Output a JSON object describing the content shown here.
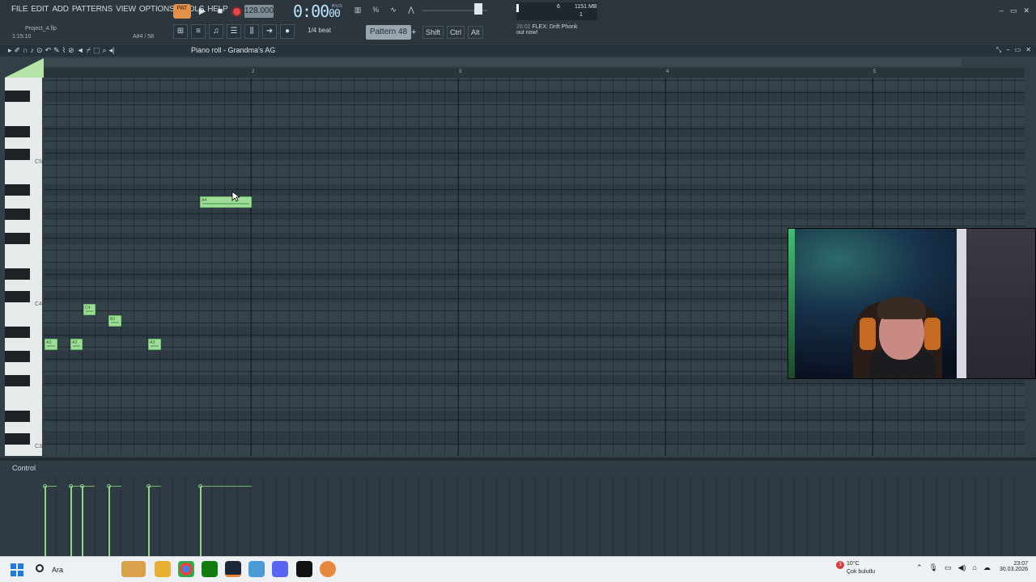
{
  "menu": [
    "FILE",
    "EDIT",
    "ADD",
    "PATTERNS",
    "VIEW",
    "OPTIONS",
    "TOOLS",
    "HELP"
  ],
  "project": {
    "name": "Project_4.flp",
    "time": "1:15:10",
    "hint": "A#4 / 58"
  },
  "transport": {
    "pat_label": "PAT",
    "tempo": "128.000",
    "clock": "0:00",
    "clock_sub": "00",
    "clock_unit": "M:S:CS"
  },
  "cpu": {
    "value_a": "6",
    "memory": "1151 MB",
    "value_c": "1"
  },
  "snap": "1/4 beat",
  "pattern": "Pattern 48",
  "modifiers": [
    "Shift",
    "Ctrl",
    "Alt"
  ],
  "news": {
    "time": "26:02",
    "line1": "FLEX: Drift Phonk",
    "line2": "out now!"
  },
  "piano_roll": {
    "title": "Piano roll - Grandma's AG"
  },
  "ruler": [
    "2",
    "3",
    "4",
    "5"
  ],
  "octaves": [
    "C5",
    "C4",
    "C3"
  ],
  "notes": [
    {
      "label": "A4",
      "pitch": "A4"
    },
    {
      "label": "C4",
      "pitch": "C4"
    },
    {
      "label": "B3",
      "pitch": "B3"
    },
    {
      "label": "A3",
      "pitch": "A3"
    },
    {
      "label": "A3",
      "pitch": "A3"
    },
    {
      "label": "A3",
      "pitch": "A3"
    }
  ],
  "control": {
    "label": "Control"
  },
  "taskbar": {
    "search": "Ara",
    "weather_badge": "3",
    "weather_temp": "10°C",
    "weather_desc": "Çok bulutlu",
    "time": "23:07",
    "date": "30.03.2026"
  },
  "colors": {
    "note": "#9edc98",
    "accent": "#e2904a",
    "record": "#e04a4a"
  }
}
